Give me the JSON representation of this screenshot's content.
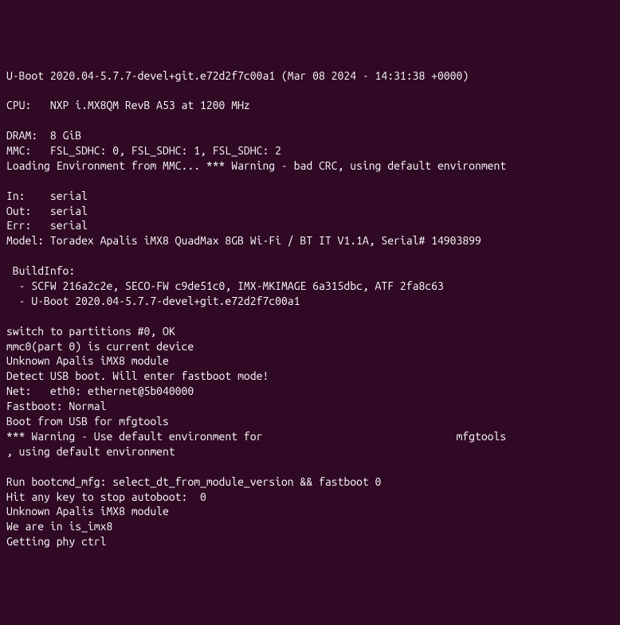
{
  "lines": [
    "U-Boot 2020.04-5.7.7-devel+git.e72d2f7c00a1 (Mar 08 2024 - 14:31:38 +0000)",
    "",
    "CPU:   NXP i.MX8QM RevB A53 at 1200 MHz",
    "",
    "DRAM:  8 GiB",
    "MMC:   FSL_SDHC: 0, FSL_SDHC: 1, FSL_SDHC: 2",
    "Loading Environment from MMC... *** Warning - bad CRC, using default environment",
    "",
    "In:    serial",
    "Out:   serial",
    "Err:   serial",
    "Model: Toradex Apalis iMX8 QuadMax 8GB Wi-Fi / BT IT V1.1A, Serial# 14903899",
    "",
    " BuildInfo:",
    "  - SCFW 216a2c2e, SECO-FW c9de51c0, IMX-MKIMAGE 6a315dbc, ATF 2fa8c63",
    "  - U-Boot 2020.04-5.7.7-devel+git.e72d2f7c00a1",
    "",
    "switch to partitions #0, OK",
    "mmc0(part 0) is current device",
    "Unknown Apalis iMX8 module",
    "Detect USB boot. Will enter fastboot mode!",
    "Net:   eth0: ethernet@5b040000",
    "Fastboot: Normal",
    "Boot from USB for mfgtools",
    "*** Warning - Use default environment for                               mfgtools",
    ", using default environment",
    "",
    "Run bootcmd_mfg: select_dt_from_module_version && fastboot 0",
    "Hit any key to stop autoboot:  0",
    "Unknown Apalis iMX8 module",
    "We are in is_imx8",
    "Getting phy ctrl"
  ]
}
